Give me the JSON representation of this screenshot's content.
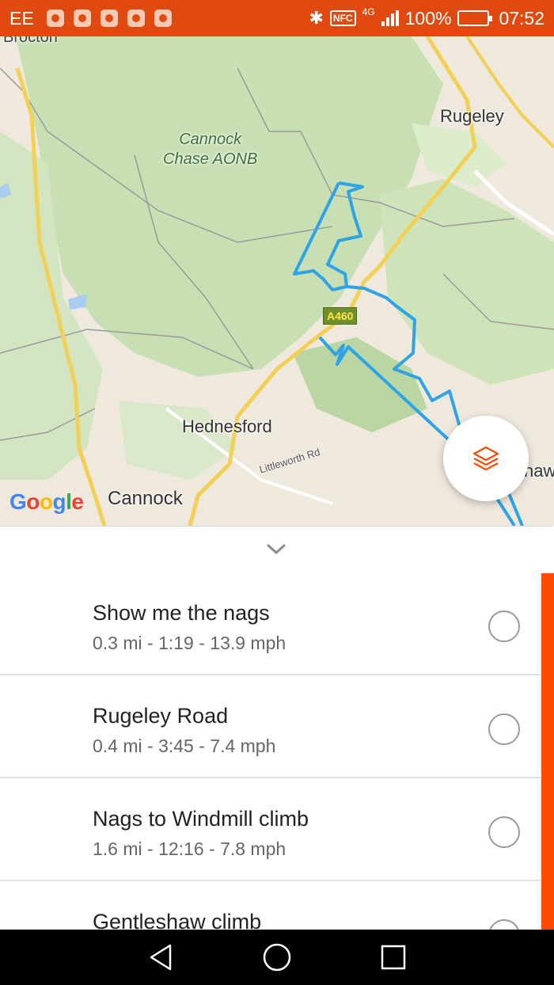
{
  "status_bar": {
    "carrier": "EE",
    "notifications": [
      "location-icon",
      "strava-icon",
      "gallery-icon",
      "gmail-icon",
      "shield-icon"
    ],
    "network_type": "4G",
    "nfc_label": "NFC",
    "battery_percent": "100%",
    "time": "07:52",
    "bluetooth_glyph": "✱",
    "colors": {
      "background": "#e0490f"
    }
  },
  "map": {
    "labels": {
      "top_partial": "Brocton",
      "area_line1": "Cannock",
      "area_line2": "Chase AONB",
      "rugeley": "Rugeley",
      "hednesford": "Hednesford",
      "cannock": "Cannock",
      "shaw_partial": "haw",
      "littleworth": "Littleworth Rd"
    },
    "road_badge": "A460",
    "attribution": {
      "g1": "G",
      "o1": "o",
      "o2": "o",
      "g2": "g",
      "l": "l",
      "e": "e"
    },
    "layers_button_icon": "layers-icon",
    "route_color": "#2ea3e6"
  },
  "sheet": {
    "collapse_icon": "chevron-down-icon",
    "segments": [
      {
        "name": "Show me the nags",
        "stats": "0.3 mi - 1:19 - 13.9 mph"
      },
      {
        "name": "Rugeley Road",
        "stats": "0.4 mi - 3:45 - 7.4 mph"
      },
      {
        "name": "Nags to Windmill climb",
        "stats": "1.6 mi - 12:16 - 7.8 mph"
      },
      {
        "name": "Gentleshaw climb",
        "stats": ""
      }
    ],
    "accent_color": "#fc4c02"
  },
  "nav_bar": {
    "buttons": [
      "back-icon",
      "home-icon",
      "recents-icon"
    ]
  }
}
